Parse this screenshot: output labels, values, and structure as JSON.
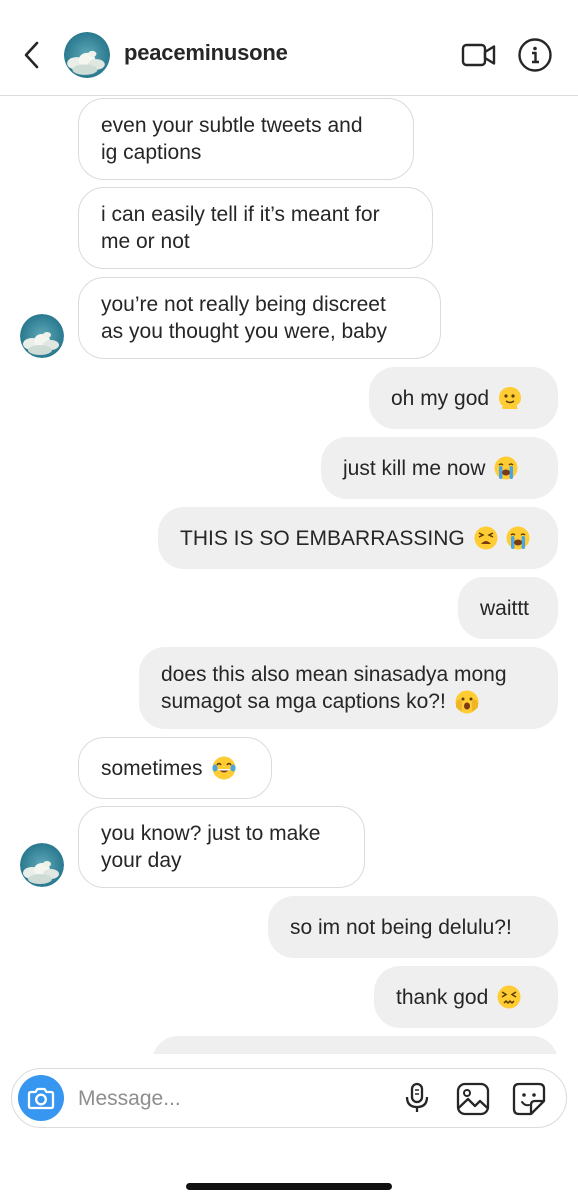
{
  "header": {
    "username": "peaceminusone",
    "back_icon": "chevron-left-icon",
    "video_icon": "video-camera-icon",
    "info_icon": "info-icon"
  },
  "messages": [
    {
      "side": "in",
      "lines": [
        "even your subtle tweets and",
        "ig captions"
      ],
      "emoji": []
    },
    {
      "side": "in",
      "lines": [
        "i can easily tell if it’s meant for",
        "me or not"
      ],
      "emoji": []
    },
    {
      "side": "in",
      "lines": [
        "you’re not really being discreet",
        "as you thought you were, baby"
      ],
      "emoji": []
    },
    {
      "side": "out",
      "lines": [
        "oh my god"
      ],
      "emoji": [
        "melting-face"
      ]
    },
    {
      "side": "out",
      "lines": [
        "just kill me now"
      ],
      "emoji": [
        "loudly-crying"
      ]
    },
    {
      "side": "out",
      "lines": [
        "THIS IS SO EMBARRASSING"
      ],
      "emoji": [
        "tired-face",
        "loudly-crying"
      ]
    },
    {
      "side": "out",
      "lines": [
        "waittt"
      ],
      "emoji": []
    },
    {
      "side": "out",
      "lines": [
        "does this also mean sinasadya mong",
        "sumagot sa mga captions ko?!"
      ],
      "emoji": [
        "face-peeking"
      ]
    },
    {
      "side": "in",
      "lines": [
        "sometimes"
      ],
      "emoji": [
        "tears-of-joy"
      ]
    },
    {
      "side": "in",
      "lines": [
        "you know? just to make",
        "your day"
      ],
      "emoji": []
    },
    {
      "side": "out",
      "lines": [
        "so im not being delulu?!"
      ],
      "emoji": []
    },
    {
      "side": "out",
      "lines": [
        "thank god"
      ],
      "emoji": [
        "confounded-face"
      ]
    }
  ],
  "composer": {
    "placeholder": "Message...",
    "camera_icon": "camera-icon",
    "mic_icon": "microphone-icon",
    "gallery_icon": "image-icon",
    "sticker_icon": "sticker-icon"
  },
  "colors": {
    "outgoing_bubble": "#efefef",
    "incoming_border": "#dbdbdb",
    "accent_blue": "#3797f0",
    "text": "#262626",
    "placeholder": "#8e8e8e"
  }
}
